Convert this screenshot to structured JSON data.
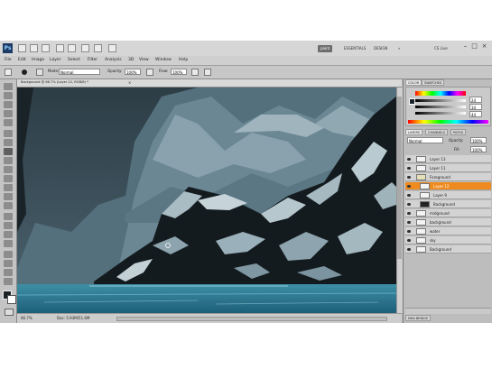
{
  "titlebar": {
    "workspaces": [
      "paint",
      "ESSENTIALS",
      "DESIGN"
    ],
    "cslive": "CS Live",
    "window_buttons": [
      "–",
      "□",
      "×"
    ]
  },
  "menubar": {
    "items": [
      "File",
      "Edit",
      "Image",
      "Layer",
      "Select",
      "Filter",
      "Analysis",
      "3D",
      "View",
      "Window",
      "Help"
    ]
  },
  "options": {
    "mode_label": "Mode:",
    "mode_value": "Normal",
    "opacity_label": "Opacity:",
    "opacity_value": "100%",
    "flow_label": "Flow:",
    "flow_value": "100%"
  },
  "document": {
    "tab_title": "Background @ 66.7% (Layer 12, RGB/8) *",
    "zoom": "66.7%",
    "doc_info": "Doc: 5.93M/51.6M"
  },
  "color_panel": {
    "tabs": [
      "COLOR",
      "SWATCHES"
    ],
    "r_value": "24",
    "g_value": "34",
    "b_value": "44"
  },
  "layers_panel": {
    "tabs": [
      "LAYERS",
      "CHANNELS",
      "PATHS"
    ],
    "blend_mode": "Normal",
    "opacity": "100%",
    "fill": "100%",
    "layers": [
      {
        "name": "Layer 13",
        "selected": false
      },
      {
        "name": "Layer 11",
        "selected": false
      },
      {
        "name": "Foreground",
        "selected": false
      },
      {
        "name": "Layer 12",
        "selected": true
      },
      {
        "name": "Layer 9",
        "selected": false
      },
      {
        "name": "Background",
        "selected": false
      },
      {
        "name": "midground",
        "selected": false
      },
      {
        "name": "background",
        "selected": false
      },
      {
        "name": "water",
        "selected": false
      },
      {
        "name": "sky",
        "selected": false
      },
      {
        "name": "Background",
        "selected": false
      }
    ]
  },
  "footer_tab": "MINI BRIDGE"
}
